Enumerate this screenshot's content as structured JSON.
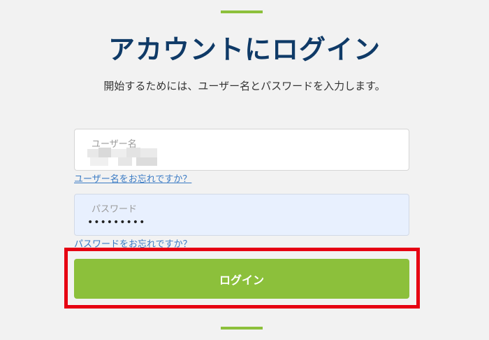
{
  "colors": {
    "accent": "#8cc03b",
    "title": "#0f3a67",
    "link": "#3b7bc4",
    "highlight": "#e60012"
  },
  "header": {
    "title": "アカウントにログイン",
    "subtitle": "開始するためには、ユーザー名とパスワードを入力します。"
  },
  "form": {
    "username": {
      "label": "ユーザー名",
      "value": ""
    },
    "forgot_username": "ユーザー名をお忘れですか？",
    "password": {
      "label": "パスワード",
      "value": "•••••••••"
    },
    "forgot_password": "パスワードをお忘れですか？",
    "login_label": "ログイン"
  }
}
